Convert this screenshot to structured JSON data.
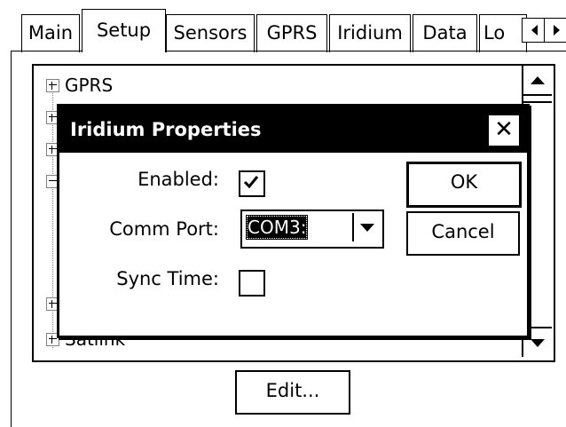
{
  "tabs": [
    {
      "label": "Main",
      "selected": false
    },
    {
      "label": "Setup",
      "selected": true
    },
    {
      "label": "Sensors",
      "selected": false
    },
    {
      "label": "GPRS",
      "selected": false
    },
    {
      "label": "Iridium",
      "selected": false
    },
    {
      "label": "Data",
      "selected": false
    },
    {
      "label": "Lo",
      "selected": false
    }
  ],
  "tree": {
    "items": [
      {
        "label": "GPRS",
        "expanded": false
      },
      {
        "label": "",
        "expanded": false
      },
      {
        "label": "",
        "expanded": false
      },
      {
        "label": "",
        "expanded": true
      },
      {
        "label": "",
        "expanded": false
      },
      {
        "label": "Satlink",
        "expanded": false
      }
    ]
  },
  "edit_button": "Edit...",
  "dialog": {
    "title": "Iridium Properties",
    "close_icon": "close-icon",
    "enabled_label": "Enabled:",
    "enabled_checked": true,
    "comm_port_label": "Comm Port:",
    "comm_port_value": "COM3:",
    "sync_time_label": "Sync Time:",
    "sync_time_checked": false,
    "ok_label": "OK",
    "cancel_label": "Cancel"
  }
}
